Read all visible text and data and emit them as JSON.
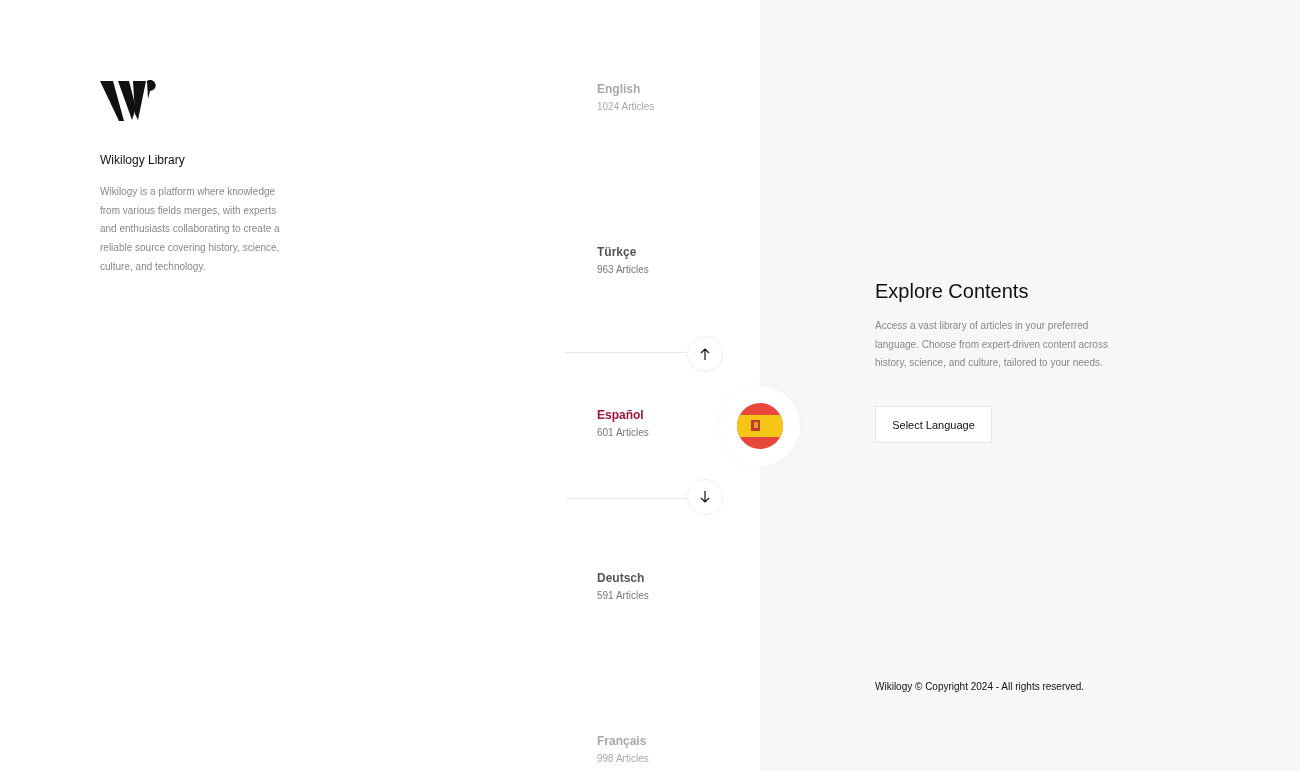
{
  "brand": {
    "name": "Wikilogy Library",
    "description": "Wikilogy is a platform where knowledge from various fields merges, with experts and enthusiasts collaborating to create a reliable source covering history, science, culture, and technology."
  },
  "languages": [
    {
      "name": "English",
      "count": "1024 Articles",
      "selected": false,
      "dimmed": true
    },
    {
      "name": "Türkçe",
      "count": "963 Articles",
      "selected": false,
      "dimmed": false
    },
    {
      "name": "Español",
      "count": "601 Articles",
      "selected": true,
      "dimmed": false
    },
    {
      "name": "Deutsch",
      "count": "591 Articles",
      "selected": false,
      "dimmed": false
    },
    {
      "name": "Français",
      "count": "998 Articles",
      "selected": false,
      "dimmed": true
    }
  ],
  "explore": {
    "title": "Explore Contents",
    "description": "Access a vast library of articles in your preferred language. Choose from expert-driven content across history, science, and culture, tailored to your needs.",
    "button": "Select Language"
  },
  "footer": "Wikilogy © Copyright 2024 - All rights reserved."
}
